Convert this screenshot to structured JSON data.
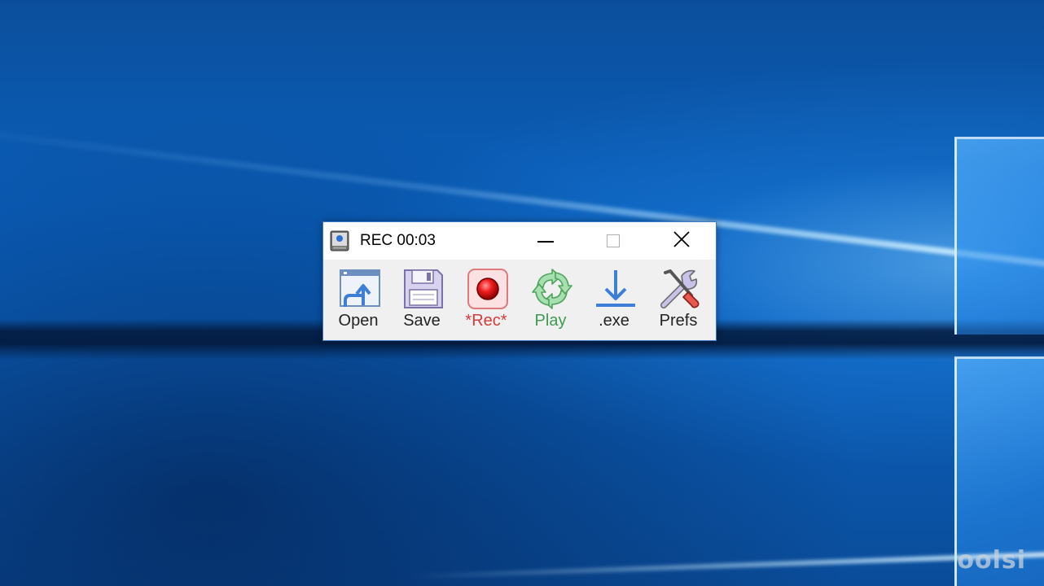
{
  "window": {
    "title": "REC 00:03",
    "app_icon": "recorder-app-icon",
    "caption": {
      "minimize": "minimize-icon",
      "maximize": "maximize-icon",
      "close": "close-icon"
    }
  },
  "toolbar": {
    "open_label": "Open",
    "save_label": "Save",
    "rec_label": "*Rec*",
    "play_label": "Play",
    "exe_label": ".exe",
    "prefs_label": "Prefs"
  },
  "colors": {
    "window_border": "#3c79c9",
    "rec_label": "#d43b3b",
    "play_label": "#3f9a4f",
    "desktop_blue": "#0a5fbb"
  },
  "watermark": "oolsi"
}
